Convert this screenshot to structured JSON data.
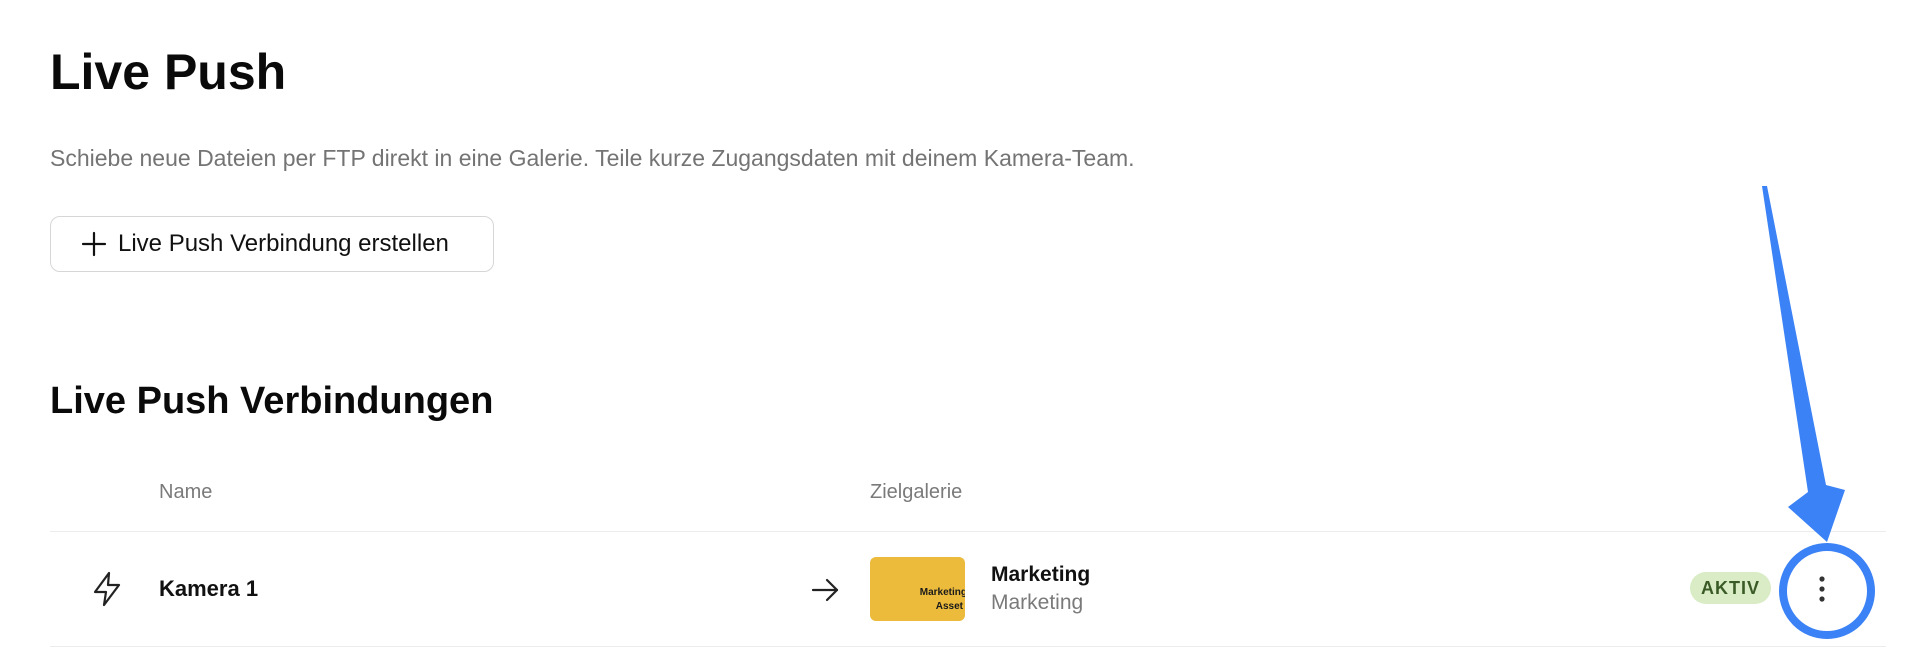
{
  "header": {
    "title": "Live Push",
    "description": "Schiebe neue Dateien per FTP direkt in eine Galerie. Teile kurze Zugangsdaten mit deinem Kamera-Team.",
    "create_button_label": "Live Push Verbindung erstellen",
    "create_button_icon": "plus-icon"
  },
  "connections": {
    "title": "Live Push Verbindungen",
    "columns": {
      "name": "Name",
      "target": "Zielgalerie"
    },
    "rows": [
      {
        "icon": "lightning-bolt-icon",
        "name": "Kamera 1",
        "arrow_icon": "arrow-right-icon",
        "gallery": {
          "thumbnail_text_line1": "Marketing",
          "thumbnail_text_line2": "Asset",
          "thumbnail_color": "#ECBB3C",
          "title": "Marketing",
          "subtitle": "Marketing"
        },
        "status": "AKTIV",
        "status_color": "#D9ECC5",
        "more_icon": "more-vertical-icon"
      }
    ]
  },
  "annotation": {
    "color": "#3B82F6",
    "shapes": [
      "arrow-annotation",
      "circle-highlight"
    ]
  }
}
